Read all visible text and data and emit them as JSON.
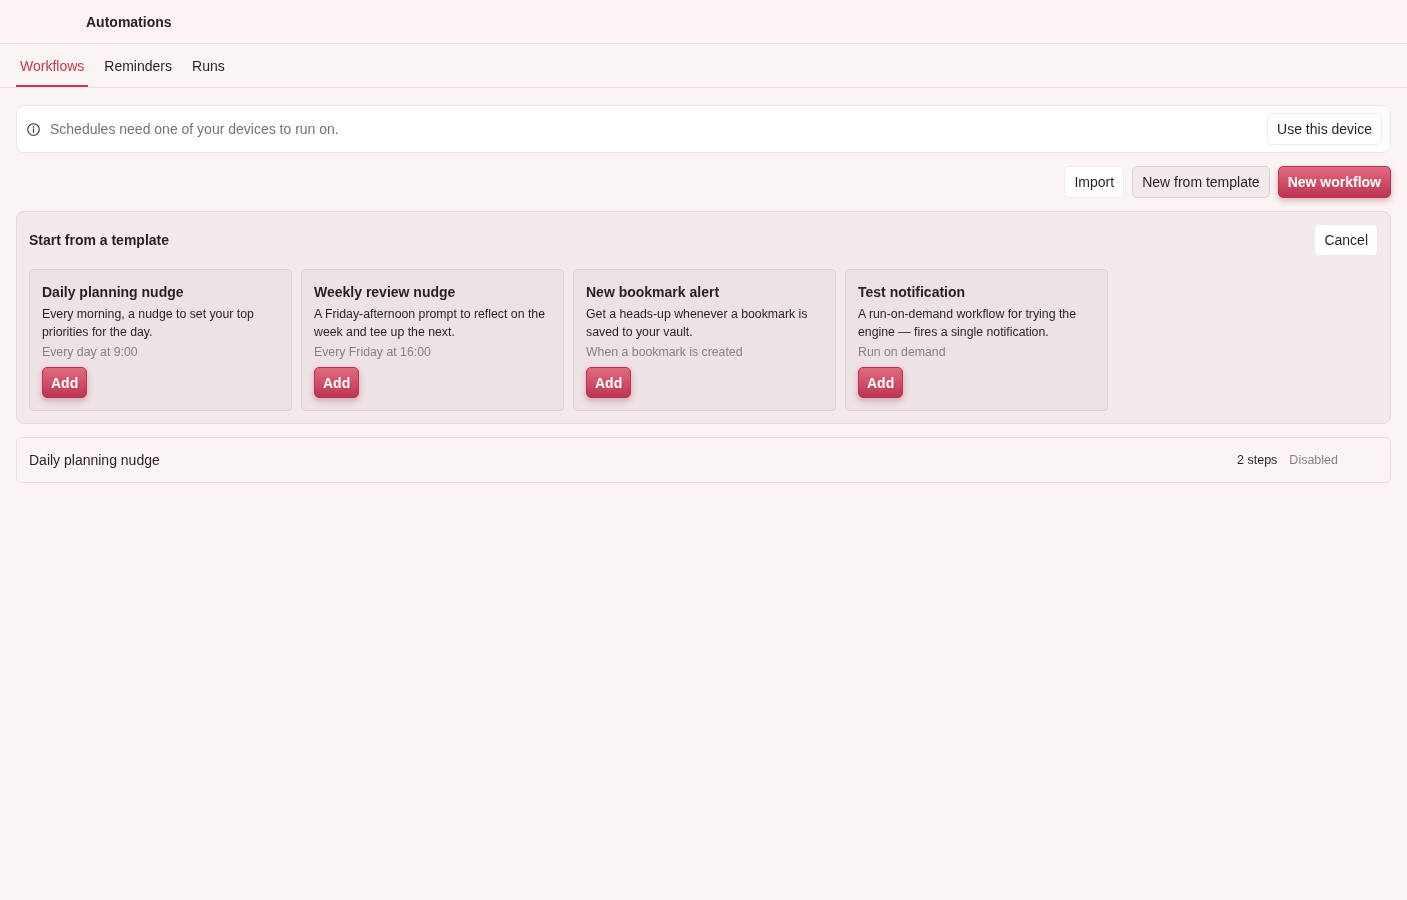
{
  "header": {
    "title": "Automations"
  },
  "tabs": [
    {
      "label": "Workflows",
      "selected": true
    },
    {
      "label": "Reminders",
      "selected": false
    },
    {
      "label": "Runs",
      "selected": false
    }
  ],
  "notice": {
    "text": "Schedules need one of your devices to run on.",
    "button": "Use this device"
  },
  "actions": [
    {
      "label": "Import",
      "kind": "plain"
    },
    {
      "label": "New from template",
      "kind": "secondary"
    },
    {
      "label": "New workflow",
      "kind": "primary"
    }
  ],
  "template_panel": {
    "title": "Start from a template",
    "cancel": "Cancel",
    "templates": [
      {
        "title": "Daily planning nudge",
        "description": "Every morning, a nudge to set your top priorities for the day.",
        "schedule": "Every day at 9:00",
        "button": "Add"
      },
      {
        "title": "Weekly review nudge",
        "description": "A Friday-afternoon prompt to reflect on the week and tee up the next.",
        "schedule": "Every Friday at 16:00",
        "button": "Add"
      },
      {
        "title": "New bookmark alert",
        "description": "Get a heads-up whenever a bookmark is saved to your vault.",
        "schedule": "When a bookmark is created",
        "button": "Add"
      },
      {
        "title": "Test notification",
        "description": "A run-on-demand workflow for trying the engine — fires a single notification.",
        "schedule": "Run on demand",
        "button": "Add"
      }
    ]
  },
  "workflows": [
    {
      "name": "Daily planning nudge",
      "steps": "2 steps",
      "status": "Disabled"
    }
  ]
}
